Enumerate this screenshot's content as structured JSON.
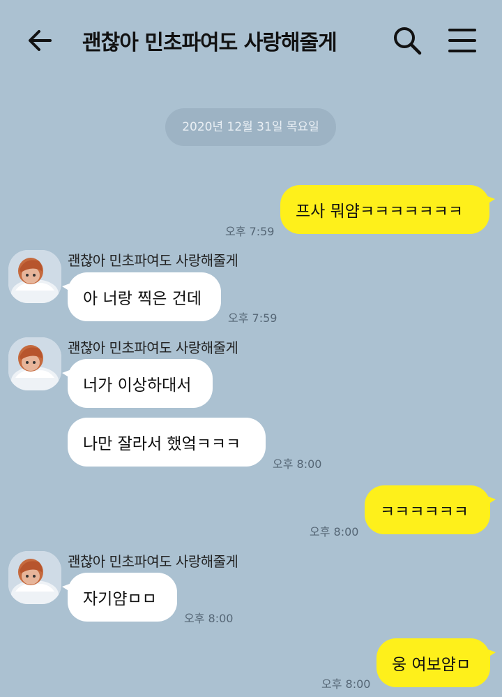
{
  "header": {
    "title": "괜찮아 민초파여도 사랑해줄게",
    "back_icon": "arrow-left-icon",
    "search_icon": "search-icon",
    "menu_icon": "hamburger-menu-icon"
  },
  "date_divider": "2020년 12월 31일 목요일",
  "messages": [
    {
      "from": "me",
      "text": "프사 뭐얌ㅋㅋㅋㅋㅋㅋㅋ",
      "time": "오후 7:59"
    },
    {
      "from": "other",
      "sender": "괜찮아 민초파여도 사랑해줄게",
      "text": "아 너랑 찍은 건데",
      "time": "오후 7:59"
    },
    {
      "from": "other",
      "sender": "괜찮아 민초파여도 사랑해줄게",
      "text": "너가 이상하대서",
      "time": ""
    },
    {
      "from": "other",
      "text": "나만 잘라서 했엌ㅋㅋㅋ",
      "time": "오후 8:00"
    },
    {
      "from": "me",
      "text": "ㅋㅋㅋㅋㅋㅋ",
      "time": "오후 8:00"
    },
    {
      "from": "other",
      "sender": "괜찮아 민초파여도 사랑해줄게",
      "text": "자기얌ㅁㅁ",
      "time": "오후 8:00"
    },
    {
      "from": "me",
      "text": "웅 여보얌ㅁ",
      "time": "오후 8:00"
    }
  ],
  "colors": {
    "background": "#abc1d1",
    "my_bubble": "#fef01b",
    "their_bubble": "#ffffff",
    "date_pill": "#9db3c4"
  }
}
